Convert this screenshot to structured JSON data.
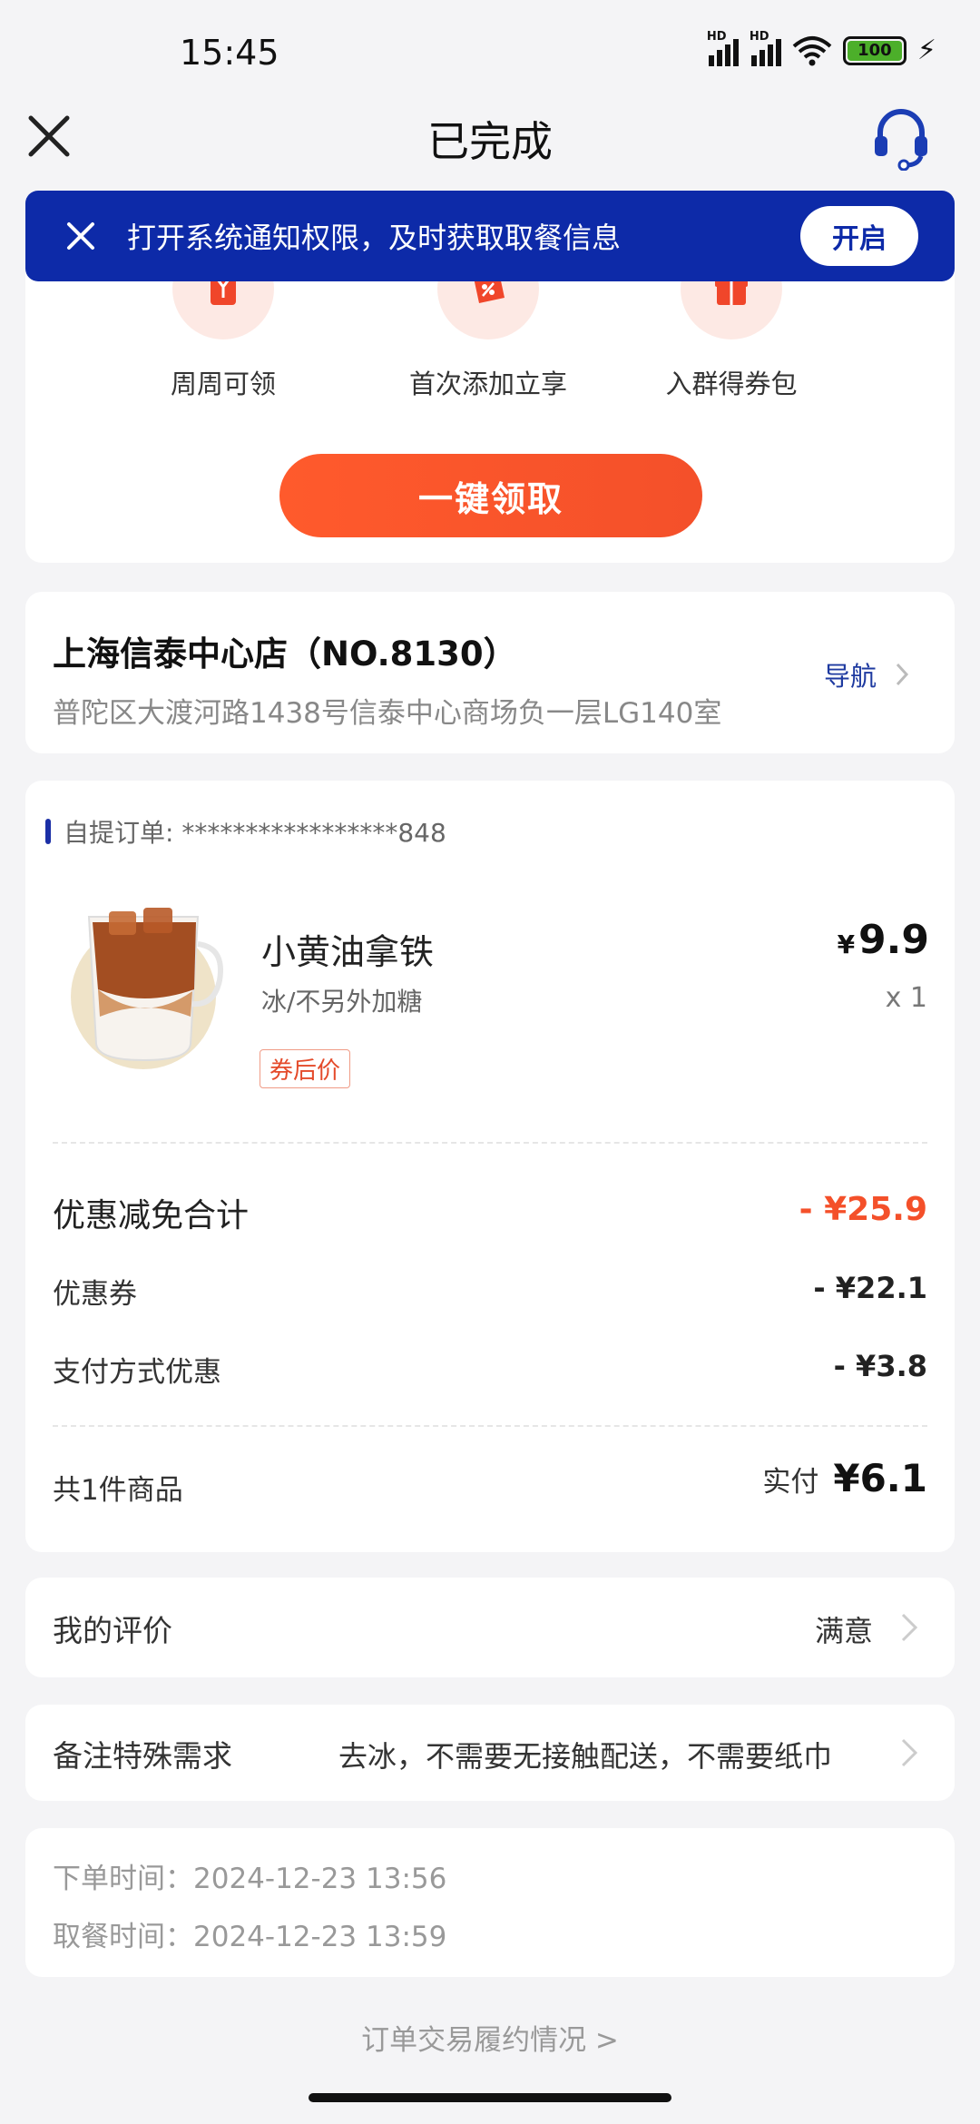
{
  "status_bar": {
    "time": "15:45",
    "battery": "100"
  },
  "header": {
    "title": "已完成"
  },
  "notify": {
    "text": "打开系统通知权限，及时获取取餐信息",
    "button": "开启"
  },
  "promo": {
    "items": [
      {
        "label": "周周可领",
        "icon": "deer-cup-icon"
      },
      {
        "label": "首次添加立享",
        "icon": "ticket-icon"
      },
      {
        "label": "入群得券包",
        "icon": "gift-icon"
      }
    ],
    "button": "一键领取"
  },
  "store": {
    "name": "上海信泰中心店（NO.8130）",
    "address": "普陀区大渡河路1438号信泰中心商场负一层LG140室",
    "nav_label": "导航"
  },
  "order": {
    "id_label": "自提订单: *****************848",
    "product": {
      "name": "小黄油拿铁",
      "spec": "冰/不另外加糖",
      "tag": "券后价",
      "price_symbol": "¥",
      "price": "9.9",
      "qty": "x 1"
    },
    "discount_total_label": "优惠减免合计",
    "discount_total_value": "- ¥25.9",
    "coupon_label": "优惠券",
    "coupon_value": "- ¥22.1",
    "payment_label": "支付方式优惠",
    "payment_value": "- ¥3.8",
    "count_label": "共1件商品",
    "paid_label": "实付",
    "paid_value": "¥6.1"
  },
  "evaluation": {
    "label": "我的评价",
    "value": "满意"
  },
  "remark": {
    "label": "备注特殊需求",
    "value": "去冰，不需要无接触配送，不需要纸巾"
  },
  "times": {
    "order_time": "下单时间：2024-12-23 13:56",
    "pickup_time": "取餐时间：2024-12-23 13:59"
  },
  "footer": {
    "link": "订单交易履约情况 >"
  },
  "colors": {
    "brand_blue": "#0d2aa8",
    "accent_red": "#f4502a"
  }
}
